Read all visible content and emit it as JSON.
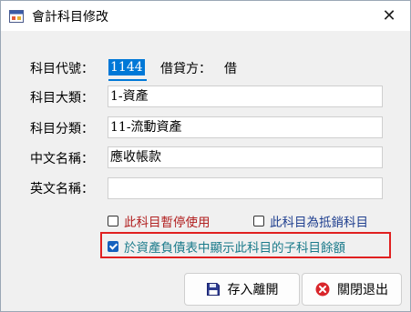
{
  "window": {
    "title": "會計科目修改",
    "close_glyph": "✕"
  },
  "form": {
    "code_label": "科目代號：",
    "code_value": "1144",
    "debit_credit_label": "借貸方：",
    "debit_credit_value": "借",
    "category_label": "科目大類：",
    "category_value": "1-資產",
    "subcategory_label": "科目分類：",
    "subcategory_value": "11-流動資產",
    "chinese_name_label": "中文名稱：",
    "chinese_name_value": "應收帳款",
    "english_name_label": "英文名稱：",
    "english_name_value": ""
  },
  "options": {
    "suspend_label": "此科目暫停使用",
    "suspend_checked": false,
    "suspend_color": "#b22222",
    "offset_label": "此科目為抵銷科目",
    "offset_checked": false,
    "offset_color": "#1f3f8f",
    "show_sub_label": "於資產負債表中顯示此科目的子科目餘額",
    "show_sub_checked": true,
    "show_sub_color": "#1a7a8a"
  },
  "buttons": {
    "save_label": "存入離開",
    "close_label": "關閉退出"
  },
  "icons": {
    "app": "window-app-icon",
    "save": "floppy-disk-icon",
    "close": "red-x-circle-icon"
  }
}
